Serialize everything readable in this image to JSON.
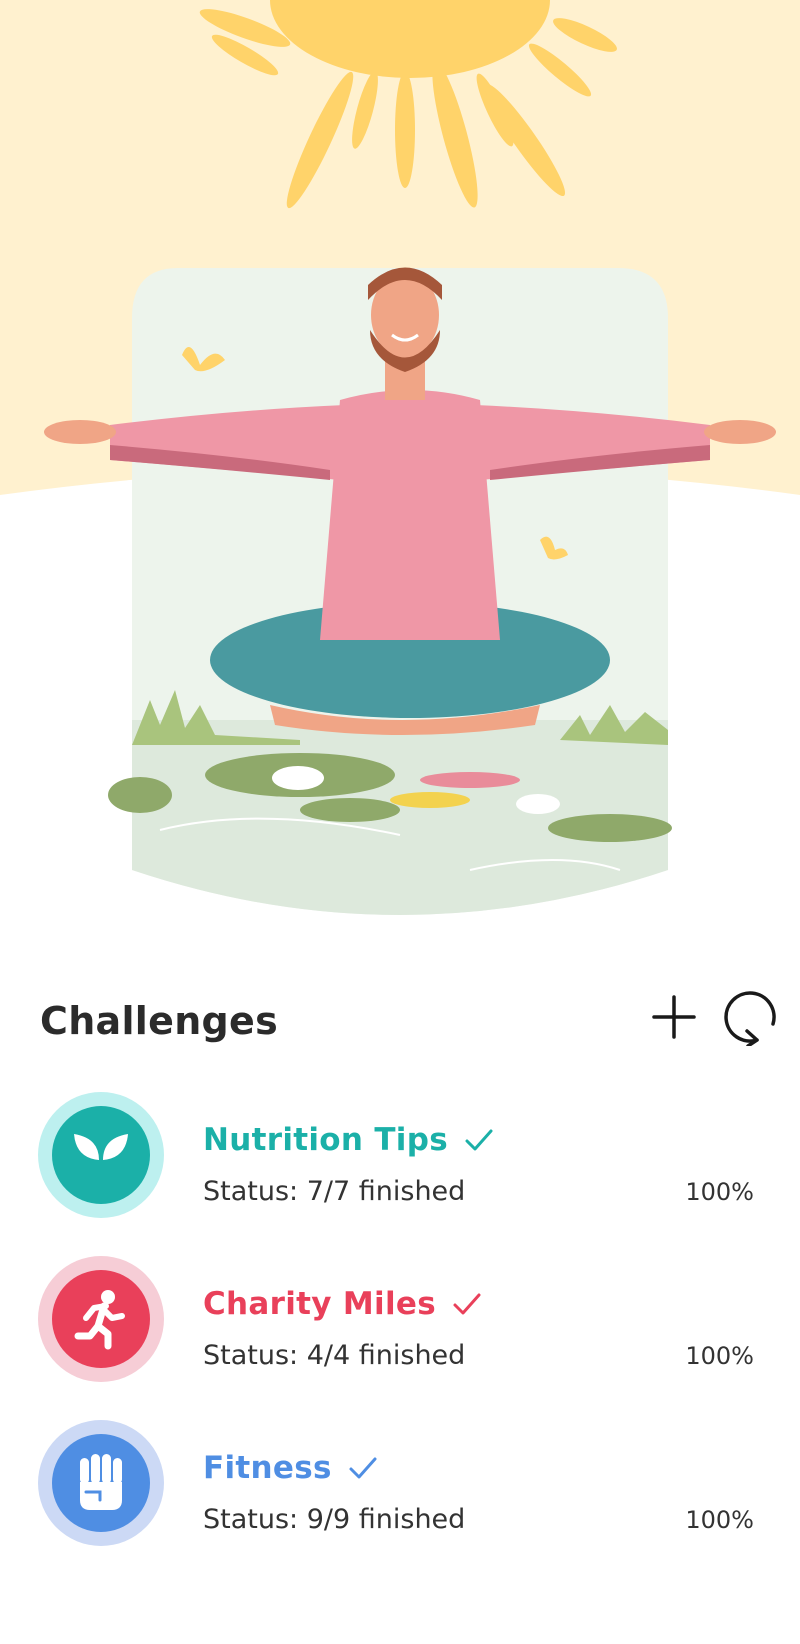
{
  "hero": {
    "illustration": "man-meditating-by-pond",
    "colors": {
      "sky": "#fff1cf",
      "sun": "#ffd36a",
      "card": "#edf4ec"
    }
  },
  "challenges_section": {
    "title": "Challenges",
    "add_icon": "plus-icon",
    "refresh_icon": "refresh-icon"
  },
  "challenges": [
    {
      "title": "Nutrition Tips",
      "status": "Status: 7/7 finished",
      "percent": "100%",
      "progress": 1.0,
      "icon": "sprout-icon",
      "color": "#1bb0a8",
      "ring_color": "#bdf0ef"
    },
    {
      "title": "Charity Miles",
      "status": "Status: 4/4 finished",
      "percent": "100%",
      "progress": 1.0,
      "icon": "running-person-icon",
      "color": "#e9405a",
      "ring_color": "#f6cdd6"
    },
    {
      "title": "Fitness",
      "status": "Status: 9/9 finished",
      "percent": "100%",
      "progress": 1.0,
      "icon": "fist-icon",
      "color": "#4f8ee3",
      "ring_color": "#ccd9f5"
    }
  ]
}
